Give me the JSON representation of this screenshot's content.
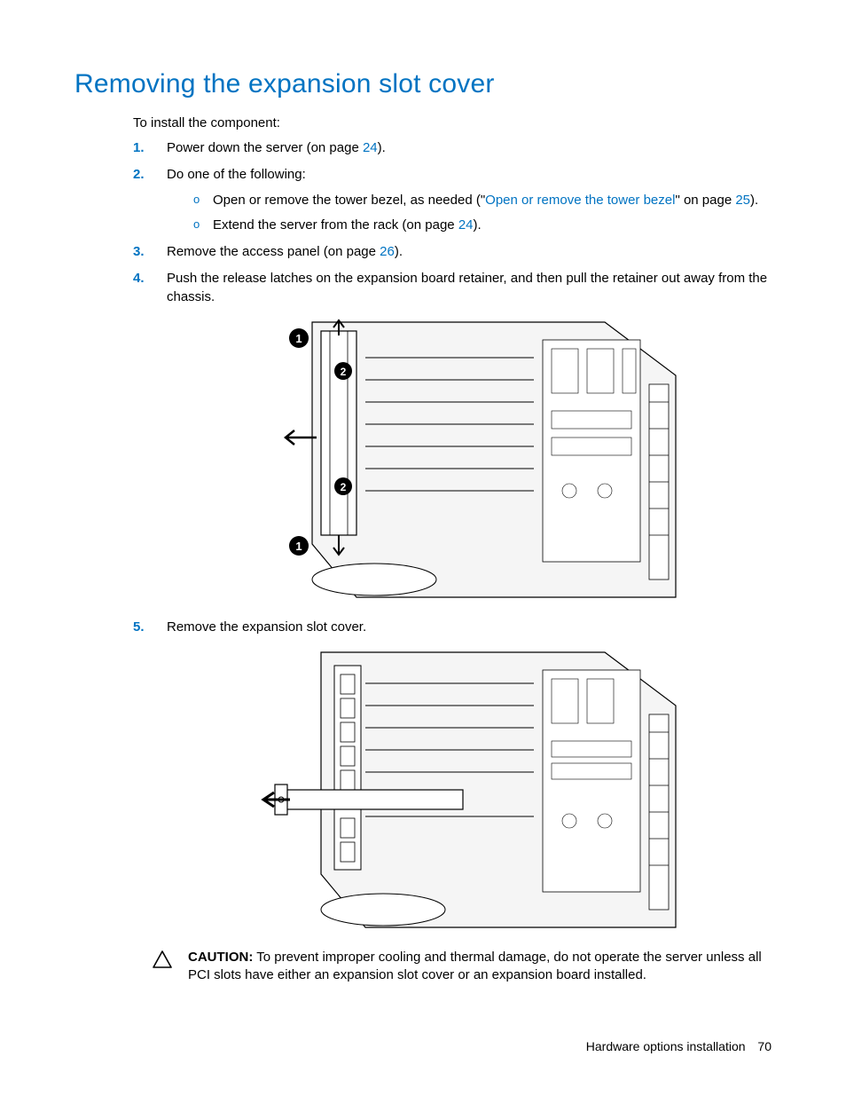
{
  "heading": "Removing the expansion slot cover",
  "intro": "To install the component:",
  "steps": [
    {
      "num": "1.",
      "text_before": "Power down the server (on page ",
      "link": "24",
      "text_after": ")."
    },
    {
      "num": "2.",
      "text_before": "Do one of the following:",
      "sub": [
        {
          "text_before": "Open or remove the tower bezel, as needed (\"",
          "link1": "Open or remove the tower bezel",
          "text_mid": "\" on page ",
          "link2": "25",
          "text_after": ")."
        },
        {
          "text_before": "Extend the server from the rack (on page ",
          "link1": "24",
          "text_after": ")."
        }
      ]
    },
    {
      "num": "3.",
      "text_before": "Remove the access panel (on page ",
      "link": "26",
      "text_after": ")."
    },
    {
      "num": "4.",
      "text_before": "Push the release latches on the expansion board retainer, and then pull the retainer out away from the chassis."
    },
    {
      "num": "5.",
      "text_before": "Remove the expansion slot cover."
    }
  ],
  "caution": {
    "label": "CAUTION:",
    "text": "To prevent improper cooling and thermal damage, do not operate the server unless all PCI slots have either an expansion slot cover or an expansion board installed."
  },
  "footer": {
    "section": "Hardware options installation",
    "page": "70"
  }
}
